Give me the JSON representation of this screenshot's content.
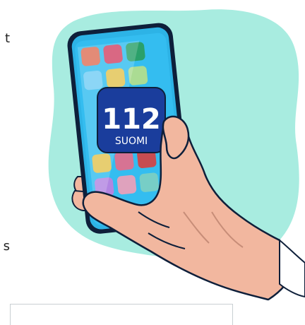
{
  "text_fragments": {
    "top": "t",
    "bottom": "s"
  },
  "phone_badge": {
    "number": "112",
    "country": "SUOMI"
  },
  "colors": {
    "blob": "#a8ece0",
    "badge": "#1a3d9c",
    "phone_screen": "#2db3e6",
    "skin": "#f2b79f"
  }
}
